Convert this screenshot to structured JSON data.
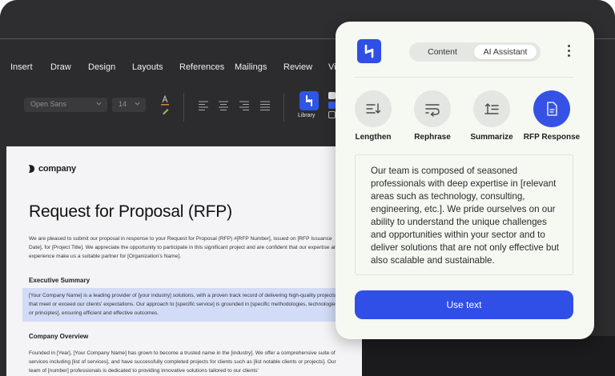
{
  "ribbon": {
    "menu": [
      "Insert",
      "Draw",
      "Design",
      "Layouts",
      "References",
      "Mailings",
      "Review",
      "Vi"
    ],
    "font_family": "Open Sans",
    "font_size": "14",
    "library_label": "Library"
  },
  "document": {
    "logo_text": "company",
    "title": "Request for Proposal (RFP)",
    "intro": "We are pleased to submit our proposal in response to your Request for Proposal (RFP) #[RFP Number], issued on [RFP Issuance Date], for [Project Title]. We appreciate the opportunity to participate in this significant project and are confident that our expertise and experience make us a suitable partner for [Organization's Name].",
    "exec_heading": "Executive Summary",
    "exec_body": "[Your Company Name] is a leading provider of [your industry] solutions, with a proven track record of delivering high-quality projects that meet or exceed our clients' expectations. Our approach to [specific service] is grounded in [specific methodologies, technologies, or principles], ensuring efficient and effective outcomes.",
    "overview_heading": "Company Overview",
    "overview_body": "Founded in [Year], [Your Company Name] has grown to become a trusted name in the [industry]. We offer a comprehensive suite of services including [list of services], and have successfully completed projects for clients such as [list notable clients or projects]. Our team of [number] professionals is dedicated to providing innovative solutions tailored to our clients'"
  },
  "assistant": {
    "tabs": [
      {
        "label": "Content",
        "active": false
      },
      {
        "label": "AI Assistant",
        "active": true
      }
    ],
    "actions": [
      {
        "label": "Lengthen",
        "icon": "lengthen-icon"
      },
      {
        "label": "Rephrase",
        "icon": "rephrase-icon"
      },
      {
        "label": "Summarize",
        "icon": "summarize-icon"
      },
      {
        "label": "RFP Response",
        "icon": "rfp-document-icon",
        "selected": true
      }
    ],
    "generated_text": "Our team is composed of seasoned professionals with deep expertise in [relevant areas such as technology, consulting, engineering, etc.]. We pride ourselves on our ability to understand the unique challenges and opportunities within your sector and to deliver solutions that are not only effective but also scalable and sustainable.",
    "use_button": "Use text"
  },
  "colors": {
    "accent": "#2f4fe6",
    "editor_dark": "#2c2c2e",
    "panel_bg": "#f6f9f2",
    "highlight": "#d3dcf6"
  }
}
